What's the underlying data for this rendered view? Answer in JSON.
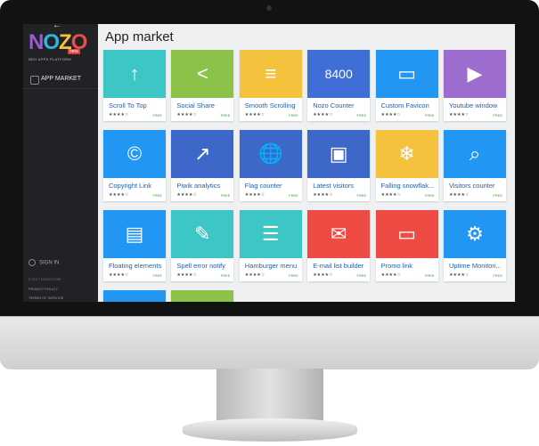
{
  "sidebar": {
    "back_glyph": "←",
    "logo": "NOZO",
    "beta": "beta",
    "tagline": "NEO APPS PLATFORM",
    "nav_item": "APP MARKET",
    "sign_in": "SIGN IN",
    "copyright": "© 2017 NOZO.COM",
    "privacy": "PRIVACY POLICY",
    "terms": "TERMS OF SERVICE"
  },
  "main": {
    "title": "App market",
    "apps": [
      {
        "name": "Scroll To Top",
        "stars": "★★★★☆",
        "free": "FREE",
        "color": "#3cc6c6",
        "icon": "↑"
      },
      {
        "name": "Social Share",
        "stars": "★★★★☆",
        "free": "FREE",
        "color": "#8bc34a",
        "icon": "<"
      },
      {
        "name": "Smooth Scrolling",
        "stars": "★★★★☆",
        "free": "FREE",
        "color": "#f4c23d",
        "icon": "≡"
      },
      {
        "name": "Nozo Counter",
        "stars": "★★★★☆",
        "free": "FREE",
        "color": "#3f6fd6",
        "icon": "8400"
      },
      {
        "name": "Custom Favicon",
        "stars": "★★★★☆",
        "free": "FREE",
        "color": "#2196f3",
        "icon": "▭"
      },
      {
        "name": "Youtube window",
        "stars": "★★★★☆",
        "free": "FREE",
        "color": "#9c6ccf",
        "icon": "▶"
      },
      {
        "name": "Copyright Link",
        "stars": "★★★★☆",
        "free": "FREE",
        "color": "#2196f3",
        "icon": "©"
      },
      {
        "name": "Piwik analytics",
        "stars": "★★★★☆",
        "free": "FREE",
        "color": "#3d67c9",
        "icon": "↗"
      },
      {
        "name": "Flag counter",
        "stars": "★★★★☆",
        "free": "FREE",
        "color": "#3d67c9",
        "icon": "🌐"
      },
      {
        "name": "Latest visitors",
        "stars": "★★★★☆",
        "free": "FREE",
        "color": "#3d67c9",
        "icon": "▣"
      },
      {
        "name": "Falling snowflak...",
        "stars": "★★★★☆",
        "free": "FREE",
        "color": "#f4c23d",
        "icon": "❄"
      },
      {
        "name": "Visitors counter",
        "stars": "★★★★☆",
        "free": "FREE",
        "color": "#2196f3",
        "icon": "⌕"
      },
      {
        "name": "Floating elements",
        "stars": "★★★★☆",
        "free": "FREE",
        "color": "#2196f3",
        "icon": "▤"
      },
      {
        "name": "Spell error notify",
        "stars": "★★★★☆",
        "free": "FREE",
        "color": "#3cc6c6",
        "icon": "✎"
      },
      {
        "name": "Hamburger menu",
        "stars": "★★★★☆",
        "free": "FREE",
        "color": "#3cc6c6",
        "icon": "☰"
      },
      {
        "name": "E-mail list builder",
        "stars": "★★★★☆",
        "free": "FREE",
        "color": "#ee4b44",
        "icon": "✉"
      },
      {
        "name": "Promo link",
        "stars": "★★★★☆",
        "free": "FREE",
        "color": "#ee4b44",
        "icon": "▭"
      },
      {
        "name": "Uptime Monitori...",
        "stars": "★★★★☆",
        "free": "FREE",
        "color": "#2196f3",
        "icon": "⚙"
      },
      {
        "name": "",
        "stars": "",
        "free": "",
        "color": "#2196f3",
        "icon": ""
      },
      {
        "name": "",
        "stars": "",
        "free": "",
        "color": "#8bc34a",
        "icon": ""
      }
    ]
  }
}
